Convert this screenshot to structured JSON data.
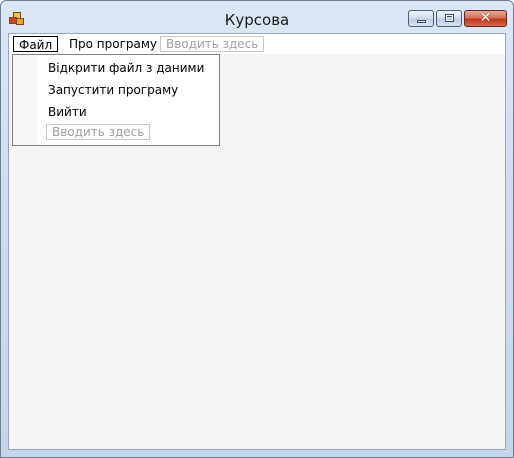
{
  "window": {
    "title": "Курсова",
    "icon": "app-window-icon",
    "controls": {
      "minimize_icon": "minimize-icon",
      "maximize_icon": "maximize-icon",
      "close_icon": "close-icon",
      "close_glyph": "✕"
    }
  },
  "menubar": {
    "items": [
      {
        "label": "Файл"
      },
      {
        "label": "Про програму"
      }
    ],
    "placeholder": "Вводить здесь"
  },
  "dropdown": {
    "items": [
      {
        "label": "Відкрити файл з даними"
      },
      {
        "label": "Запустити програму"
      },
      {
        "label": "Вийти"
      }
    ],
    "placeholder": "Вводить здесь"
  },
  "colors": {
    "client_background": "#f5f5f5",
    "close_button": "#c0391f",
    "title_bar": "#cfdeef"
  }
}
